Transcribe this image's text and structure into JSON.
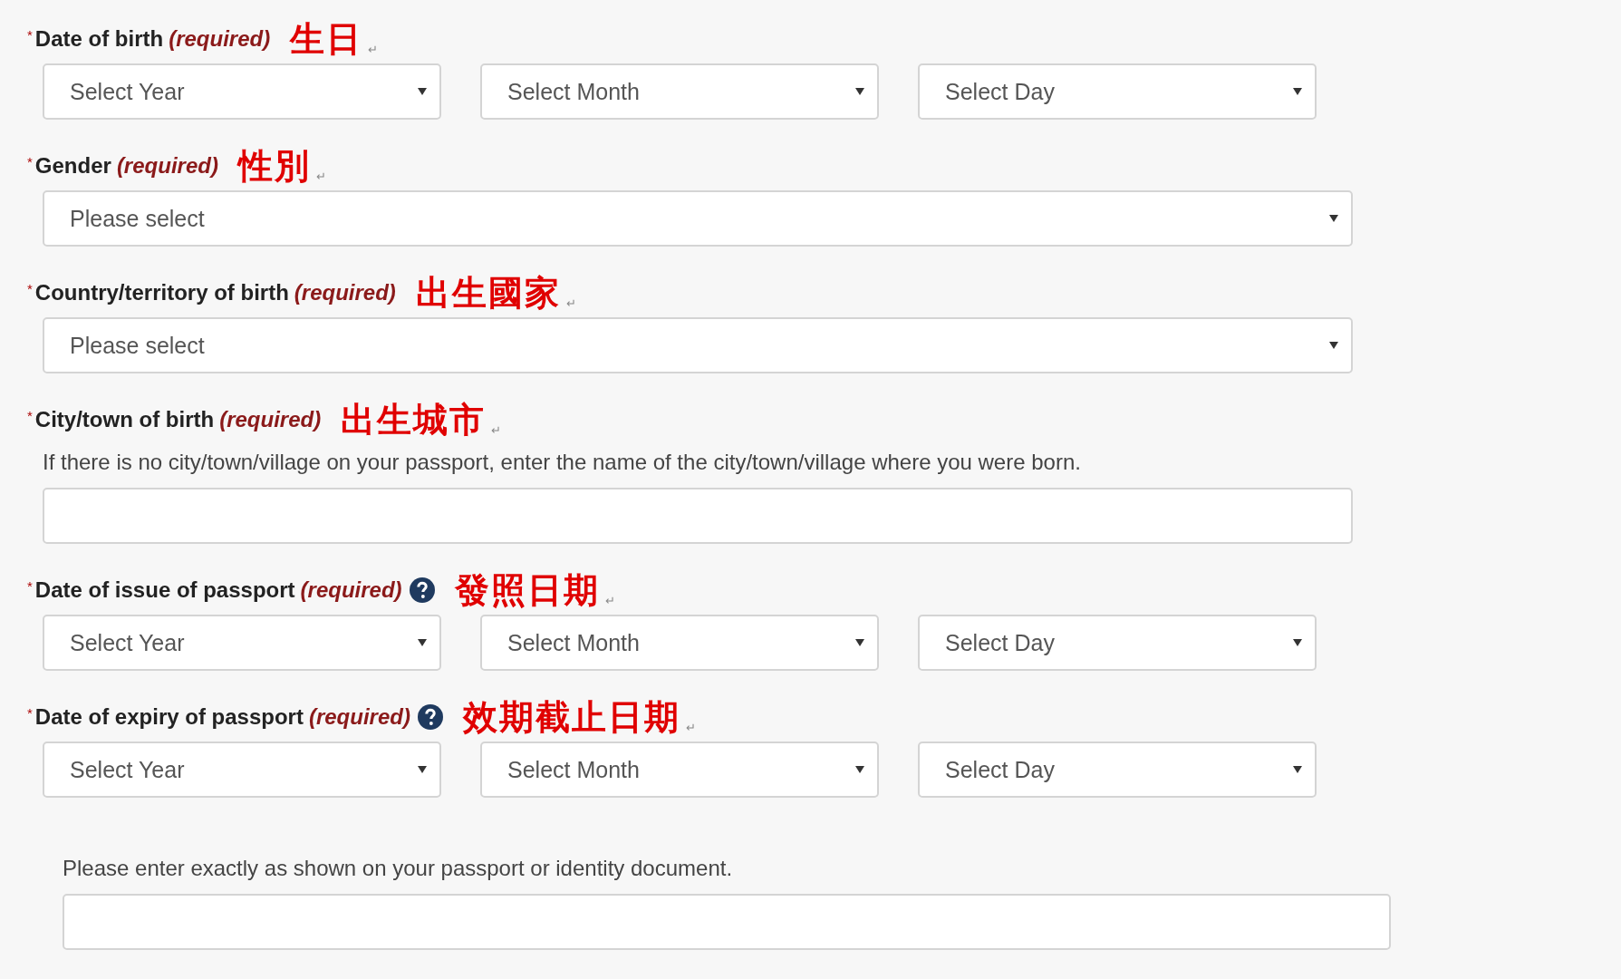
{
  "fields": [
    {
      "kind": "date",
      "asterisk": "*",
      "label": "Date of birth",
      "required": "(required)",
      "chinese": "生日",
      "mark": "↵",
      "selects": [
        "Select Year",
        "Select Month",
        "Select Day"
      ]
    },
    {
      "kind": "select",
      "asterisk": "*",
      "label": "Gender",
      "required": "(required)",
      "chinese": "性別",
      "mark": "↵",
      "selects": [
        "Please select"
      ]
    },
    {
      "kind": "select",
      "asterisk": "*",
      "label": "Country/territory of birth",
      "required": "(required)",
      "chinese": "出生國家",
      "mark": "↵",
      "selects": [
        "Please select"
      ]
    },
    {
      "kind": "text",
      "asterisk": "*",
      "label": "City/town of birth",
      "required": "(required)",
      "chinese": "出生城市",
      "mark": "↵",
      "help": "If there is no city/town/village on your passport, enter the name of the city/town/village where you were born."
    },
    {
      "kind": "date",
      "asterisk": "*",
      "label": "Date of issue of passport",
      "required": "(required)",
      "info_icon": true,
      "chinese": "發照日期",
      "mark": "↵",
      "selects": [
        "Select Year",
        "Select Month",
        "Select Day"
      ]
    },
    {
      "kind": "date",
      "asterisk": "*",
      "label": "Date of expiry of passport",
      "required": "(required)",
      "info_icon": true,
      "chinese": "效期截止日期",
      "mark": "↵",
      "selects": [
        "Select Year",
        "Select Month",
        "Select Day"
      ]
    },
    {
      "kind": "text",
      "help": "Please enter exactly as shown on your passport or identity document."
    }
  ]
}
